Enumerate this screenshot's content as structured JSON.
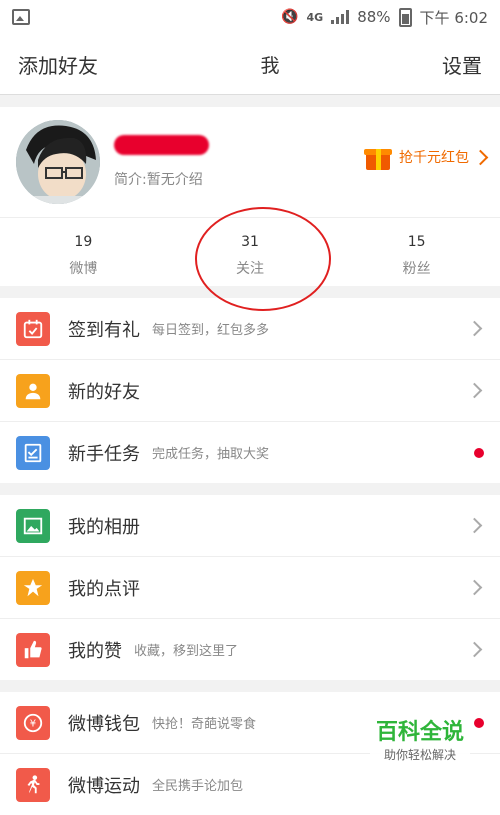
{
  "status_bar": {
    "network": "4G",
    "battery": "88%",
    "time": "下午 6:02"
  },
  "nav": {
    "left": "添加好友",
    "title": "我",
    "right": "设置"
  },
  "profile": {
    "bio": "简介:暂无介绍",
    "red_packet": "抢千元红包",
    "stats": [
      {
        "num": "19",
        "label": "微博"
      },
      {
        "num": "31",
        "label": "关注"
      },
      {
        "num": "15",
        "label": "粉丝"
      }
    ]
  },
  "menu_group1": [
    {
      "label": "签到有礼",
      "desc": "每日签到，红包多多",
      "color": "#f15a4a",
      "icon": "calendar-check-icon"
    },
    {
      "label": "新的好友",
      "desc": "",
      "color": "#f7a21c",
      "icon": "person-icon"
    },
    {
      "label": "新手任务",
      "desc": "完成任务，抽取大奖",
      "color": "#4a90e2",
      "icon": "checklist-icon"
    }
  ],
  "menu_group2": [
    {
      "label": "我的相册",
      "desc": "",
      "color": "#2fa85f",
      "icon": "photo-icon"
    },
    {
      "label": "我的点评",
      "desc": "",
      "color": "#f7a21c",
      "icon": "star-icon"
    },
    {
      "label": "我的赞",
      "desc": "收藏，移到这里了",
      "color": "#f15a4a",
      "icon": "thumbs-up-icon"
    }
  ],
  "menu_group3": [
    {
      "label": "微博钱包",
      "desc": "快抢！奇葩说零食",
      "color": "#f15a4a",
      "icon": "wallet-icon"
    },
    {
      "label": "微博运动",
      "desc": "全民携手论加包",
      "color": "#f15a4a",
      "icon": "running-icon"
    }
  ],
  "watermark": {
    "title": "百科全说",
    "subtitle": "助你轻松解决"
  }
}
